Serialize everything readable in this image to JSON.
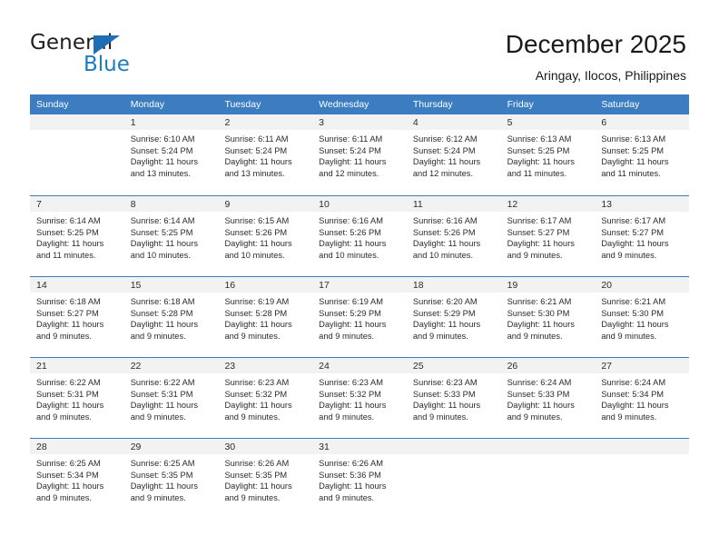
{
  "brand": {
    "name_part1": "General",
    "name_part2": "Blue",
    "logo_icon": "blue-triangle-icon"
  },
  "header": {
    "title": "December 2025",
    "subtitle": "Aringay, Ilocos, Philippines"
  },
  "colors": {
    "header_blue": "#3b7dc0",
    "day_number_background": "#f2f2f2",
    "brand_blue": "#1a7cc4",
    "text": "#2b2b2b"
  },
  "calendar": {
    "weekdays": [
      "Sunday",
      "Monday",
      "Tuesday",
      "Wednesday",
      "Thursday",
      "Friday",
      "Saturday"
    ],
    "weeks": [
      [
        {
          "day": "",
          "sunrise": "",
          "sunset": "",
          "daylight1": "",
          "daylight2": ""
        },
        {
          "day": "1",
          "sunrise": "Sunrise: 6:10 AM",
          "sunset": "Sunset: 5:24 PM",
          "daylight1": "Daylight: 11 hours",
          "daylight2": "and 13 minutes."
        },
        {
          "day": "2",
          "sunrise": "Sunrise: 6:11 AM",
          "sunset": "Sunset: 5:24 PM",
          "daylight1": "Daylight: 11 hours",
          "daylight2": "and 13 minutes."
        },
        {
          "day": "3",
          "sunrise": "Sunrise: 6:11 AM",
          "sunset": "Sunset: 5:24 PM",
          "daylight1": "Daylight: 11 hours",
          "daylight2": "and 12 minutes."
        },
        {
          "day": "4",
          "sunrise": "Sunrise: 6:12 AM",
          "sunset": "Sunset: 5:24 PM",
          "daylight1": "Daylight: 11 hours",
          "daylight2": "and 12 minutes."
        },
        {
          "day": "5",
          "sunrise": "Sunrise: 6:13 AM",
          "sunset": "Sunset: 5:25 PM",
          "daylight1": "Daylight: 11 hours",
          "daylight2": "and 11 minutes."
        },
        {
          "day": "6",
          "sunrise": "Sunrise: 6:13 AM",
          "sunset": "Sunset: 5:25 PM",
          "daylight1": "Daylight: 11 hours",
          "daylight2": "and 11 minutes."
        }
      ],
      [
        {
          "day": "7",
          "sunrise": "Sunrise: 6:14 AM",
          "sunset": "Sunset: 5:25 PM",
          "daylight1": "Daylight: 11 hours",
          "daylight2": "and 11 minutes."
        },
        {
          "day": "8",
          "sunrise": "Sunrise: 6:14 AM",
          "sunset": "Sunset: 5:25 PM",
          "daylight1": "Daylight: 11 hours",
          "daylight2": "and 10 minutes."
        },
        {
          "day": "9",
          "sunrise": "Sunrise: 6:15 AM",
          "sunset": "Sunset: 5:26 PM",
          "daylight1": "Daylight: 11 hours",
          "daylight2": "and 10 minutes."
        },
        {
          "day": "10",
          "sunrise": "Sunrise: 6:16 AM",
          "sunset": "Sunset: 5:26 PM",
          "daylight1": "Daylight: 11 hours",
          "daylight2": "and 10 minutes."
        },
        {
          "day": "11",
          "sunrise": "Sunrise: 6:16 AM",
          "sunset": "Sunset: 5:26 PM",
          "daylight1": "Daylight: 11 hours",
          "daylight2": "and 10 minutes."
        },
        {
          "day": "12",
          "sunrise": "Sunrise: 6:17 AM",
          "sunset": "Sunset: 5:27 PM",
          "daylight1": "Daylight: 11 hours",
          "daylight2": "and 9 minutes."
        },
        {
          "day": "13",
          "sunrise": "Sunrise: 6:17 AM",
          "sunset": "Sunset: 5:27 PM",
          "daylight1": "Daylight: 11 hours",
          "daylight2": "and 9 minutes."
        }
      ],
      [
        {
          "day": "14",
          "sunrise": "Sunrise: 6:18 AM",
          "sunset": "Sunset: 5:27 PM",
          "daylight1": "Daylight: 11 hours",
          "daylight2": "and 9 minutes."
        },
        {
          "day": "15",
          "sunrise": "Sunrise: 6:18 AM",
          "sunset": "Sunset: 5:28 PM",
          "daylight1": "Daylight: 11 hours",
          "daylight2": "and 9 minutes."
        },
        {
          "day": "16",
          "sunrise": "Sunrise: 6:19 AM",
          "sunset": "Sunset: 5:28 PM",
          "daylight1": "Daylight: 11 hours",
          "daylight2": "and 9 minutes."
        },
        {
          "day": "17",
          "sunrise": "Sunrise: 6:19 AM",
          "sunset": "Sunset: 5:29 PM",
          "daylight1": "Daylight: 11 hours",
          "daylight2": "and 9 minutes."
        },
        {
          "day": "18",
          "sunrise": "Sunrise: 6:20 AM",
          "sunset": "Sunset: 5:29 PM",
          "daylight1": "Daylight: 11 hours",
          "daylight2": "and 9 minutes."
        },
        {
          "day": "19",
          "sunrise": "Sunrise: 6:21 AM",
          "sunset": "Sunset: 5:30 PM",
          "daylight1": "Daylight: 11 hours",
          "daylight2": "and 9 minutes."
        },
        {
          "day": "20",
          "sunrise": "Sunrise: 6:21 AM",
          "sunset": "Sunset: 5:30 PM",
          "daylight1": "Daylight: 11 hours",
          "daylight2": "and 9 minutes."
        }
      ],
      [
        {
          "day": "21",
          "sunrise": "Sunrise: 6:22 AM",
          "sunset": "Sunset: 5:31 PM",
          "daylight1": "Daylight: 11 hours",
          "daylight2": "and 9 minutes."
        },
        {
          "day": "22",
          "sunrise": "Sunrise: 6:22 AM",
          "sunset": "Sunset: 5:31 PM",
          "daylight1": "Daylight: 11 hours",
          "daylight2": "and 9 minutes."
        },
        {
          "day": "23",
          "sunrise": "Sunrise: 6:23 AM",
          "sunset": "Sunset: 5:32 PM",
          "daylight1": "Daylight: 11 hours",
          "daylight2": "and 9 minutes."
        },
        {
          "day": "24",
          "sunrise": "Sunrise: 6:23 AM",
          "sunset": "Sunset: 5:32 PM",
          "daylight1": "Daylight: 11 hours",
          "daylight2": "and 9 minutes."
        },
        {
          "day": "25",
          "sunrise": "Sunrise: 6:23 AM",
          "sunset": "Sunset: 5:33 PM",
          "daylight1": "Daylight: 11 hours",
          "daylight2": "and 9 minutes."
        },
        {
          "day": "26",
          "sunrise": "Sunrise: 6:24 AM",
          "sunset": "Sunset: 5:33 PM",
          "daylight1": "Daylight: 11 hours",
          "daylight2": "and 9 minutes."
        },
        {
          "day": "27",
          "sunrise": "Sunrise: 6:24 AM",
          "sunset": "Sunset: 5:34 PM",
          "daylight1": "Daylight: 11 hours",
          "daylight2": "and 9 minutes."
        }
      ],
      [
        {
          "day": "28",
          "sunrise": "Sunrise: 6:25 AM",
          "sunset": "Sunset: 5:34 PM",
          "daylight1": "Daylight: 11 hours",
          "daylight2": "and 9 minutes."
        },
        {
          "day": "29",
          "sunrise": "Sunrise: 6:25 AM",
          "sunset": "Sunset: 5:35 PM",
          "daylight1": "Daylight: 11 hours",
          "daylight2": "and 9 minutes."
        },
        {
          "day": "30",
          "sunrise": "Sunrise: 6:26 AM",
          "sunset": "Sunset: 5:35 PM",
          "daylight1": "Daylight: 11 hours",
          "daylight2": "and 9 minutes."
        },
        {
          "day": "31",
          "sunrise": "Sunrise: 6:26 AM",
          "sunset": "Sunset: 5:36 PM",
          "daylight1": "Daylight: 11 hours",
          "daylight2": "and 9 minutes."
        },
        {
          "day": "",
          "sunrise": "",
          "sunset": "",
          "daylight1": "",
          "daylight2": ""
        },
        {
          "day": "",
          "sunrise": "",
          "sunset": "",
          "daylight1": "",
          "daylight2": ""
        },
        {
          "day": "",
          "sunrise": "",
          "sunset": "",
          "daylight1": "",
          "daylight2": ""
        }
      ]
    ]
  }
}
